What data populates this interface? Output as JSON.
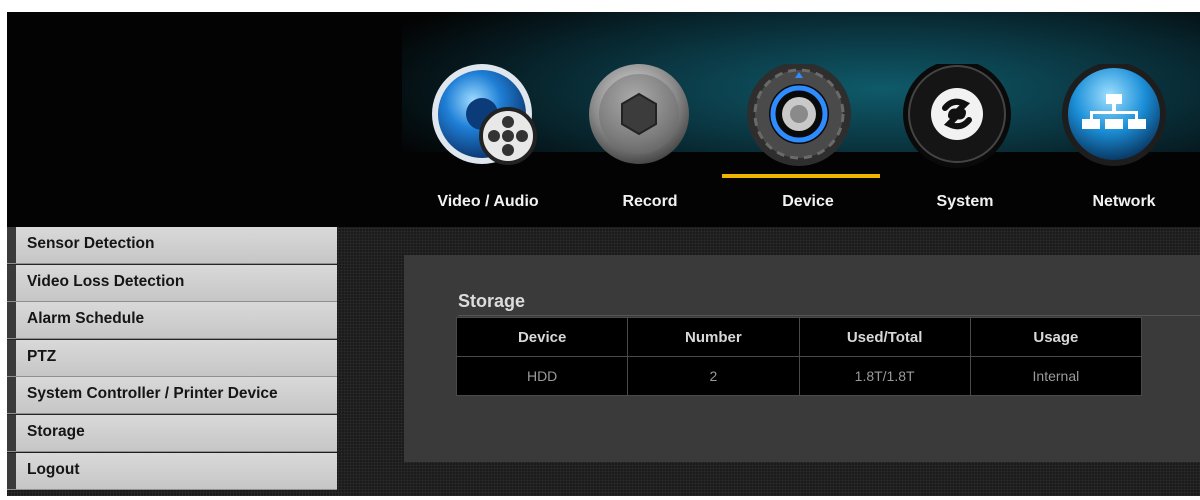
{
  "nav": {
    "tabs": [
      {
        "label": "Video / Audio",
        "icon": "video-audio-icon"
      },
      {
        "label": "Record",
        "icon": "camera-aperture-icon"
      },
      {
        "label": "Device",
        "icon": "device-gear-icon"
      },
      {
        "label": "System",
        "icon": "system-icon"
      },
      {
        "label": "Network",
        "icon": "network-icon"
      }
    ],
    "active": "Device",
    "accent": "#f0b400"
  },
  "sidebar": {
    "items": [
      {
        "label": "Sensor Detection"
      },
      {
        "label": "Video Loss Detection"
      },
      {
        "label": "Alarm Schedule"
      },
      {
        "label": "PTZ"
      },
      {
        "label": "System Controller / Printer Device"
      },
      {
        "label": "Storage"
      },
      {
        "label": "Logout"
      }
    ]
  },
  "storage": {
    "title": "Storage",
    "columns": [
      "Device",
      "Number",
      "Used/Total",
      "Usage"
    ],
    "rows": [
      [
        "HDD",
        "2",
        "1.8T/1.8T",
        "Internal"
      ]
    ]
  }
}
